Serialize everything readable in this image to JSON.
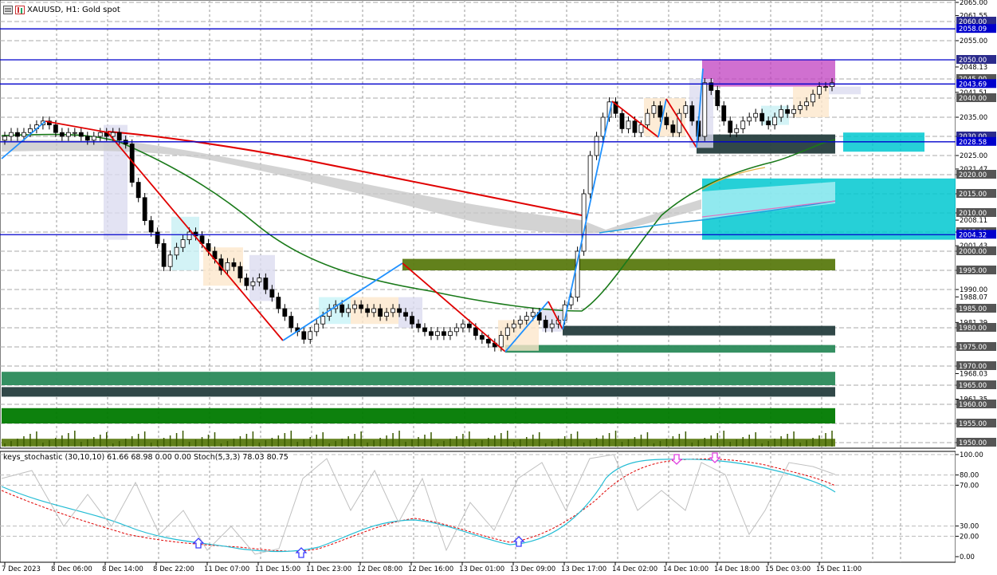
{
  "header": {
    "symbol_timeframe": "XAUUSD, H1:",
    "description": "Gold spot"
  },
  "indicator_header": {
    "text": "keys_stochastic (30,10,10) 61.66 68.98 0.00 0.00 Stoch(5,3,3) 78.03 80.75"
  },
  "price_axis": {
    "ticks": [
      "2065.00",
      "2061.55",
      "2055.00",
      "2048.13",
      "2041.51",
      "2035.00",
      "2030.00",
      "2025.00",
      "2021.47",
      "2020.00",
      "2015.00",
      "2010.00",
      "2008.11",
      "2005.00",
      "2001.43",
      "2000.00",
      "1995.00",
      "1990.00",
      "1988.07",
      "1985.00",
      "1981.39",
      "1980.00",
      "1975.00",
      "1970.00",
      "1968.03",
      "1965.00",
      "1961.35",
      "1960.00",
      "1955.00",
      "1950.00"
    ],
    "badges": [
      {
        "text": "2060.00",
        "color": "#2b2b8c"
      },
      {
        "text": "2058.09",
        "color": "#0000cc"
      },
      {
        "text": "2050.00",
        "color": "#2b2b8c"
      },
      {
        "text": "2045.00",
        "color": "#555555"
      },
      {
        "text": "2043.69",
        "color": "#0000cc"
      },
      {
        "text": "2040.00",
        "color": "#555555"
      },
      {
        "text": "2030.00",
        "color": "#2b2b8c"
      },
      {
        "text": "2028.58",
        "color": "#0000cc"
      },
      {
        "text": "2020.00",
        "color": "#555555"
      },
      {
        "text": "2015.00",
        "color": "#555555"
      },
      {
        "text": "2010.00",
        "color": "#555555"
      },
      {
        "text": "2005.00",
        "color": "#555555"
      },
      {
        "text": "2004.32",
        "color": "#0000cc"
      },
      {
        "text": "2000.00",
        "color": "#555555"
      },
      {
        "text": "1995.00",
        "color": "#555555"
      },
      {
        "text": "1985.00",
        "color": "#555555"
      },
      {
        "text": "1980.00",
        "color": "#555555"
      },
      {
        "text": "1975.00",
        "color": "#555555"
      },
      {
        "text": "1970.00",
        "color": "#555555"
      },
      {
        "text": "1965.00",
        "color": "#555555"
      },
      {
        "text": "1960.00",
        "color": "#555555"
      },
      {
        "text": "1955.00",
        "color": "#555555"
      },
      {
        "text": "1950.00",
        "color": "#555555"
      }
    ]
  },
  "stoch_axis": {
    "ticks": [
      "100.00",
      "80.00",
      "70.00",
      "30.00",
      "20.00",
      "0.00"
    ]
  },
  "time_axis": {
    "labels": [
      "7 Dec 2023",
      "8 Dec 06:00",
      "8 Dec 14:00",
      "8 Dec 22:00",
      "11 Dec 07:00",
      "11 Dec 15:00",
      "11 Dec 23:00",
      "12 Dec 08:00",
      "12 Dec 16:00",
      "13 Dec 01:00",
      "13 Dec 09:00",
      "13 Dec 17:00",
      "14 Dec 02:00",
      "14 Dec 10:00",
      "14 Dec 18:00",
      "15 Dec 03:00",
      "15 Dec 11:00"
    ]
  },
  "horizontal_levels": [
    2058.09,
    2050.0,
    2043.69,
    2028.58,
    2004.32
  ],
  "zones": [
    {
      "name": "magenta-supply-zone",
      "from": 2043,
      "to": 2050,
      "color": "#c040c0"
    },
    {
      "name": "cyan-zone-right",
      "from": 2026,
      "to": 2031,
      "color": "#00c8d0"
    },
    {
      "name": "cyan-big-zone",
      "from": 2003,
      "to": 2019,
      "color": "#00c8d0"
    },
    {
      "name": "dark-zone-upper",
      "from": 2025.5,
      "to": 2030.5,
      "color": "#263e3e"
    },
    {
      "name": "olive-zone",
      "from": 1995,
      "to": 1998,
      "color": "#5a7a10"
    },
    {
      "name": "dark-zone-mid",
      "from": 1978,
      "to": 1980.5,
      "color": "#263e3e"
    },
    {
      "name": "green-zone-mid",
      "from": 1973.5,
      "to": 1975.5,
      "color": "#2a8a5a"
    },
    {
      "name": "green-zone-low",
      "from": 1965,
      "to": 1968.5,
      "color": "#2a8a5a"
    },
    {
      "name": "dark-zone-low",
      "from": 1962,
      "to": 1964.5,
      "color": "#263e3e"
    },
    {
      "name": "bright-green-zone",
      "from": 1955,
      "to": 1959,
      "color": "#007a00"
    },
    {
      "name": "olive-base-zone",
      "from": 1949,
      "to": 1951,
      "color": "#5a7a10"
    }
  ],
  "colors": {
    "up_candle": "#ffffff",
    "down_candle": "#000000",
    "zigzag_up": "#1e90ff",
    "zigzag_down": "#e00000",
    "ma_green": "#1a7a1a",
    "ma_red": "#e00000",
    "stoch_main": "#22bcd4",
    "stoch_signal": "#e00000",
    "stoch_grey": "#c0c0c0",
    "arrow_up": "#3a3aff",
    "arrow_down": "#e040e0"
  }
}
